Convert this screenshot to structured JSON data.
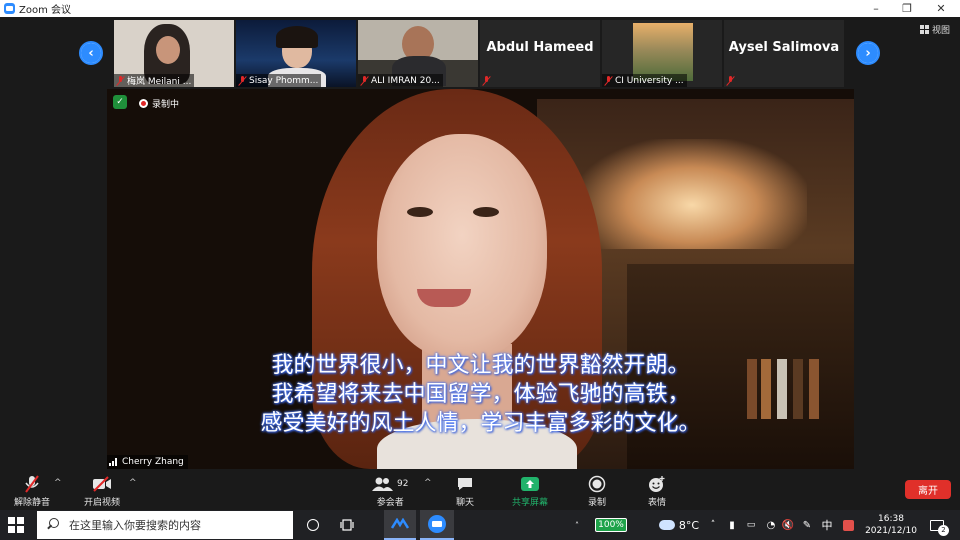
{
  "window": {
    "title": "Zoom 会议",
    "minimize": "–",
    "restore": "❐",
    "close": "✕"
  },
  "top": {
    "view_label": "视图"
  },
  "participants_strip": [
    {
      "name": "梅岚 Meilani ...",
      "type": "video"
    },
    {
      "name": "Sisay Phomm...",
      "type": "video"
    },
    {
      "name": "ALI IMRAN 20...",
      "type": "video"
    },
    {
      "name": "Abdul Hameed",
      "type": "name_only"
    },
    {
      "name": "CI University ...",
      "type": "video"
    },
    {
      "name": "Aysel Salimova",
      "type": "name_only"
    }
  ],
  "speaker": {
    "name": "Cherry Zhang",
    "recording_label": "录制中",
    "subtitles": [
      "我的世界很小，中文让我的世界豁然开朗。",
      "我希望将来去中国留学，体验飞驰的高铁，",
      "感受美好的风土人情，学习丰富多彩的文化。"
    ]
  },
  "toolbar": {
    "unmute": "解除静音",
    "start_video": "开启视频",
    "participants": "参会者",
    "participants_count": "92",
    "chat": "聊天",
    "share_screen": "共享屏幕",
    "record": "录制",
    "reactions": "表情",
    "leave": "离开"
  },
  "colors": {
    "accent": "#2d8cff",
    "share_green": "#21b36b",
    "leave_red": "#e0302a",
    "battery_green": "#1fa34a"
  },
  "taskbar": {
    "search_placeholder": "在这里输入你要搜索的内容",
    "battery": "100%",
    "temperature": "8°C",
    "ime": "中",
    "time": "16:38",
    "date": "2021/12/10",
    "notification_count": "2"
  }
}
